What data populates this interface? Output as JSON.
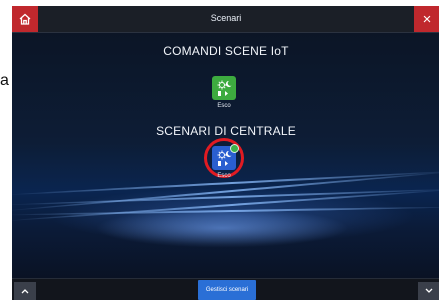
{
  "side_letter": "a",
  "header": {
    "title": "Scenari",
    "close_label": "×"
  },
  "sections": [
    {
      "title": "COMANDI SCENE IoT",
      "scenes": [
        {
          "label": "Esco",
          "icon": "sun-moon-scene-icon",
          "color": "#3dab3f"
        }
      ]
    },
    {
      "title": "SCENARI DI CENTRALE",
      "scenes": [
        {
          "label": "Esco",
          "icon": "sun-moon-scene-icon",
          "color": "#2a5fd0"
        }
      ]
    }
  ],
  "footer": {
    "manage_label": "Gestisci scenari"
  },
  "colors": {
    "accent_red": "#c0282d",
    "button_blue": "#2a6fd6",
    "iot_green": "#3dab3f",
    "highlight_ring": "#e11b22"
  }
}
